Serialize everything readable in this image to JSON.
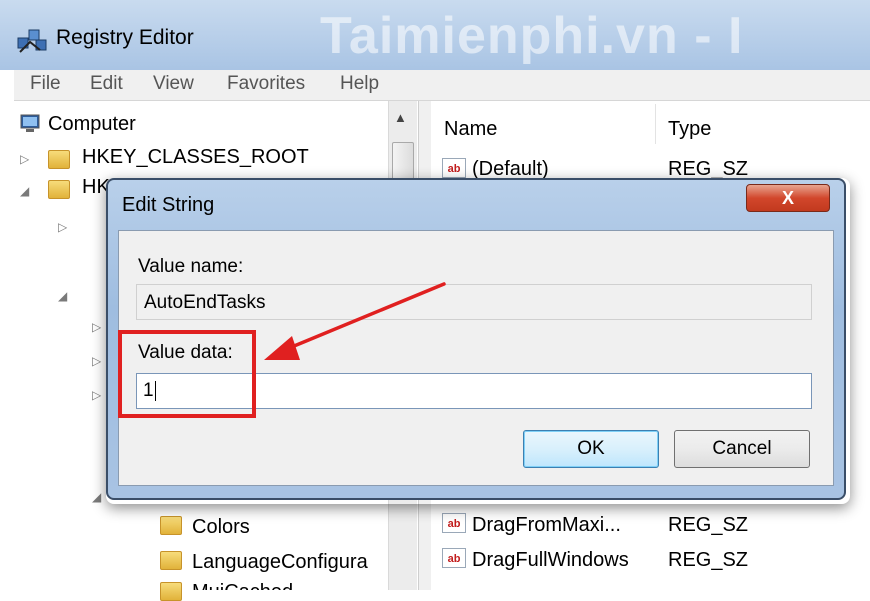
{
  "window": {
    "title": "Registry Editor",
    "watermark": "Taimienphi.vn - I"
  },
  "menu": [
    "File",
    "Edit",
    "View",
    "Favorites",
    "Help"
  ],
  "tree": {
    "root": "Computer",
    "items": [
      {
        "label": "HKEY_CLASSES_ROOT"
      },
      {
        "label": "HK"
      }
    ],
    "lower_items": [
      {
        "label": "Colors"
      },
      {
        "label": "LanguageConfigura"
      },
      {
        "label": "MuiCached"
      }
    ]
  },
  "columns": {
    "name": "Name",
    "type": "Type"
  },
  "values": {
    "default_name": "(Default)",
    "default_type": "REG_SZ",
    "rows": [
      {
        "name": "DragFromMaxi...",
        "type": "REG_SZ"
      },
      {
        "name": "DragFullWindows",
        "type": "REG_SZ"
      }
    ],
    "icon_text": "ab"
  },
  "dialog": {
    "title": "Edit String",
    "close_glyph": "X",
    "value_name_label": "Value name:",
    "value_name": "AutoEndTasks",
    "value_data_label": "Value data:",
    "value_data": "1",
    "ok_label": "OK",
    "cancel_label": "Cancel"
  },
  "colors": {
    "highlight": "#e02020",
    "titlebar": "#a9c4e4"
  }
}
